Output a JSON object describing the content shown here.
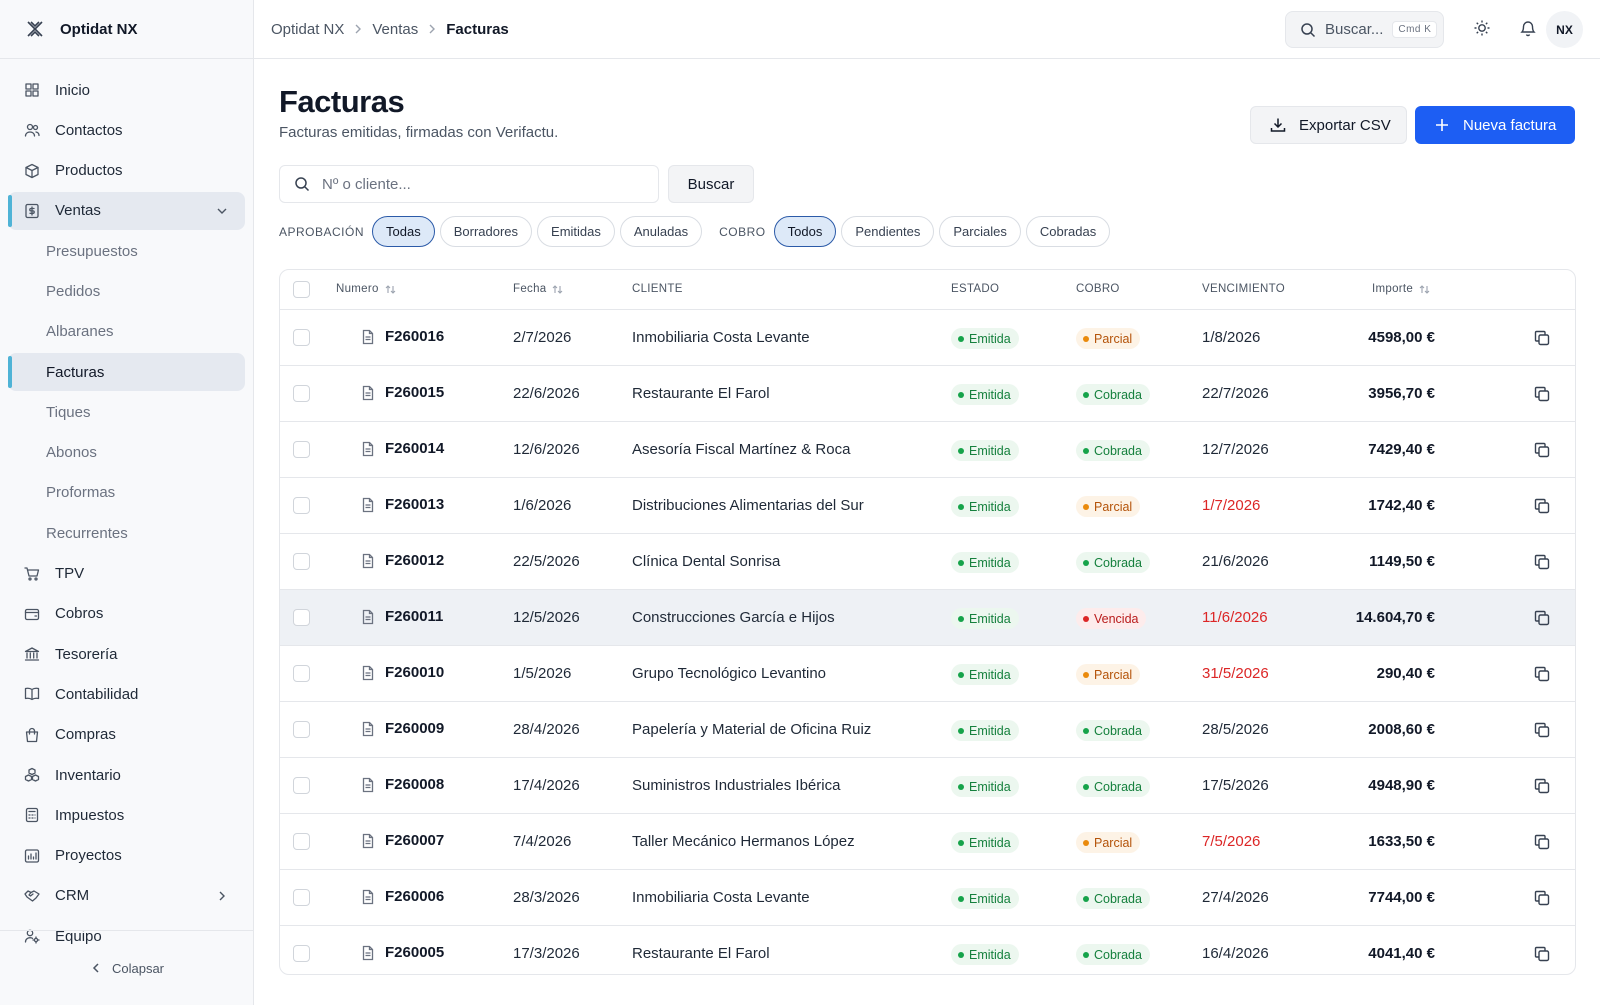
{
  "app": {
    "name": "Optidat NX",
    "avatar_initials": "NX"
  },
  "breadcrumb": [
    "Optidat NX",
    "Ventas",
    "Facturas"
  ],
  "topbar": {
    "search_placeholder": "Buscar...",
    "shortcut": "Cmd K"
  },
  "sidebar": {
    "items": [
      {
        "label": "Inicio",
        "icon": "grid-icon"
      },
      {
        "label": "Contactos",
        "icon": "users-icon"
      },
      {
        "label": "Productos",
        "icon": "box-icon"
      },
      {
        "label": "Ventas",
        "icon": "invoice-icon",
        "active": true,
        "expanded": true
      },
      {
        "label": "Presupuestos",
        "sub": true
      },
      {
        "label": "Pedidos",
        "sub": true
      },
      {
        "label": "Albaranes",
        "sub": true
      },
      {
        "label": "Facturas",
        "sub": true,
        "active": true
      },
      {
        "label": "Tiques",
        "sub": true
      },
      {
        "label": "Abonos",
        "sub": true
      },
      {
        "label": "Proformas",
        "sub": true
      },
      {
        "label": "Recurrentes",
        "sub": true
      },
      {
        "label": "TPV",
        "icon": "cart-icon"
      },
      {
        "label": "Cobros",
        "icon": "wallet-icon"
      },
      {
        "label": "Tesorería",
        "icon": "bank-icon"
      },
      {
        "label": "Contabilidad",
        "icon": "book-icon"
      },
      {
        "label": "Compras",
        "icon": "shopping-bag-icon"
      },
      {
        "label": "Inventario",
        "icon": "boxes-icon"
      },
      {
        "label": "Impuestos",
        "icon": "calculator-icon"
      },
      {
        "label": "Proyectos",
        "icon": "chart-icon"
      },
      {
        "label": "CRM",
        "icon": "handshake-icon",
        "has_children": true
      },
      {
        "label": "Equipo",
        "icon": "user-settings-icon"
      }
    ],
    "collapse_label": "Colapsar"
  },
  "page": {
    "title": "Facturas",
    "subtitle": "Facturas emitidas, firmadas con Verifactu.",
    "export_label": "Exportar CSV",
    "new_label": "Nueva factura",
    "search_placeholder": "Nº o cliente...",
    "search_button": "Buscar"
  },
  "filters": {
    "aprobacion_label": "APROBACIÓN",
    "aprobacion": [
      "Todas",
      "Borradores",
      "Emitidas",
      "Anuladas"
    ],
    "aprobacion_active": "Todas",
    "cobro_label": "COBRO",
    "cobro": [
      "Todos",
      "Pendientes",
      "Parciales",
      "Cobradas"
    ],
    "cobro_active": "Todos"
  },
  "table": {
    "headers": {
      "numero": "Numero",
      "fecha": "Fecha",
      "cliente": "CLIENTE",
      "estado": "ESTADO",
      "cobro": "COBRO",
      "vencimiento": "VENCIMIENTO",
      "importe": "Importe"
    },
    "rows": [
      {
        "numero": "F260016",
        "fecha": "2/7/2026",
        "cliente": "Inmobiliaria Costa Levante",
        "estado": "Emitida",
        "cobro": "Parcial",
        "vencimiento": "1/8/2026",
        "overdue": false,
        "importe": "4598,00 €"
      },
      {
        "numero": "F260015",
        "fecha": "22/6/2026",
        "cliente": "Restaurante El Farol",
        "estado": "Emitida",
        "cobro": "Cobrada",
        "vencimiento": "22/7/2026",
        "overdue": false,
        "importe": "3956,70 €"
      },
      {
        "numero": "F260014",
        "fecha": "12/6/2026",
        "cliente": "Asesoría Fiscal Martínez & Roca",
        "estado": "Emitida",
        "cobro": "Cobrada",
        "vencimiento": "12/7/2026",
        "overdue": false,
        "importe": "7429,40 €"
      },
      {
        "numero": "F260013",
        "fecha": "1/6/2026",
        "cliente": "Distribuciones Alimentarias del Sur",
        "estado": "Emitida",
        "cobro": "Parcial",
        "vencimiento": "1/7/2026",
        "overdue": true,
        "importe": "1742,40 €"
      },
      {
        "numero": "F260012",
        "fecha": "22/5/2026",
        "cliente": "Clínica Dental Sonrisa",
        "estado": "Emitida",
        "cobro": "Cobrada",
        "vencimiento": "21/6/2026",
        "overdue": false,
        "importe": "1149,50 €"
      },
      {
        "numero": "F260011",
        "fecha": "12/5/2026",
        "cliente": "Construcciones García e Hijos",
        "estado": "Emitida",
        "cobro": "Vencida",
        "vencimiento": "11/6/2026",
        "overdue": true,
        "importe": "14.604,70 €",
        "highlighted": true
      },
      {
        "numero": "F260010",
        "fecha": "1/5/2026",
        "cliente": "Grupo Tecnológico Levantino",
        "estado": "Emitida",
        "cobro": "Parcial",
        "vencimiento": "31/5/2026",
        "overdue": true,
        "importe": "290,40 €"
      },
      {
        "numero": "F260009",
        "fecha": "28/4/2026",
        "cliente": "Papelería y Material de Oficina Ruiz",
        "estado": "Emitida",
        "cobro": "Cobrada",
        "vencimiento": "28/5/2026",
        "overdue": false,
        "importe": "2008,60 €"
      },
      {
        "numero": "F260008",
        "fecha": "17/4/2026",
        "cliente": "Suministros Industriales Ibérica",
        "estado": "Emitida",
        "cobro": "Cobrada",
        "vencimiento": "17/5/2026",
        "overdue": false,
        "importe": "4948,90 €"
      },
      {
        "numero": "F260007",
        "fecha": "7/4/2026",
        "cliente": "Taller Mecánico Hermanos López",
        "estado": "Emitida",
        "cobro": "Parcial",
        "vencimiento": "7/5/2026",
        "overdue": true,
        "importe": "1633,50 €"
      },
      {
        "numero": "F260006",
        "fecha": "28/3/2026",
        "cliente": "Inmobiliaria Costa Levante",
        "estado": "Emitida",
        "cobro": "Cobrada",
        "vencimiento": "27/4/2026",
        "overdue": false,
        "importe": "7744,00 €"
      },
      {
        "numero": "F260005",
        "fecha": "17/3/2026",
        "cliente": "Restaurante El Farol",
        "estado": "Emitida",
        "cobro": "Cobrada",
        "vencimiento": "16/4/2026",
        "overdue": false,
        "importe": "4041,40 €"
      }
    ]
  },
  "colors": {
    "accent": "#1d5ef3",
    "active_indicator": "#4fb3d6",
    "overdue": "#dc2626",
    "success": "#16a34a",
    "warning": "#ea8a0c"
  }
}
